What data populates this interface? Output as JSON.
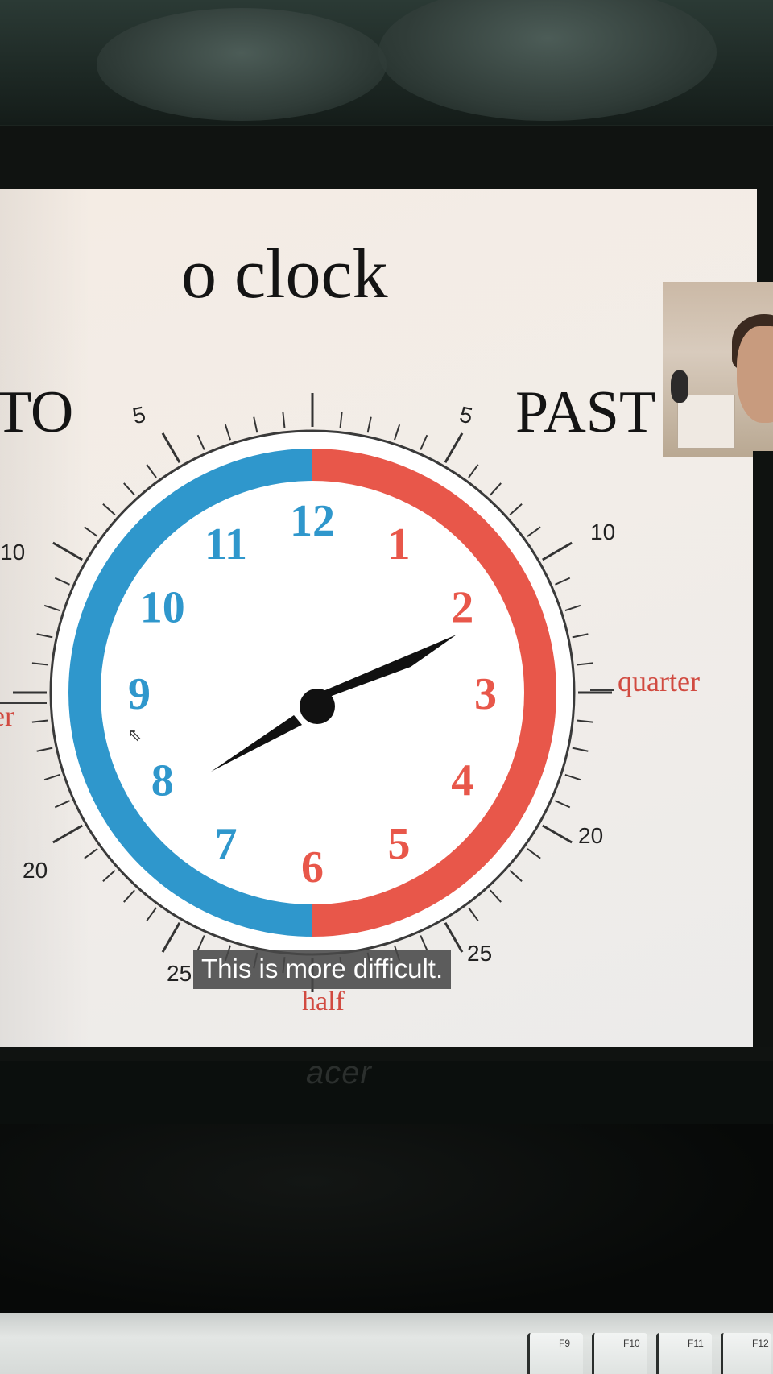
{
  "slide": {
    "title": "o clock",
    "to_label": "TO",
    "past_label": "PAST",
    "quarter_label": "quarter",
    "quarter_left_fragment": "er",
    "half_label": "half",
    "minute_labels": {
      "past_5": "5",
      "past_10": "10",
      "past_20": "20",
      "past_25": "25",
      "to_5": "5",
      "to_10": "10",
      "to_20": "20",
      "to_25": "25"
    },
    "hours": [
      "12",
      "1",
      "2",
      "3",
      "4",
      "5",
      "6",
      "7",
      "8",
      "9",
      "10",
      "11"
    ],
    "colors": {
      "past": "#e8574a",
      "to": "#2f97cc",
      "hand": "#111111"
    }
  },
  "subtitle": "This is more difficult.",
  "monitor": {
    "brand": "acer"
  },
  "keyboard": {
    "keys": [
      "F9",
      "F10",
      "F11",
      "F12"
    ]
  }
}
